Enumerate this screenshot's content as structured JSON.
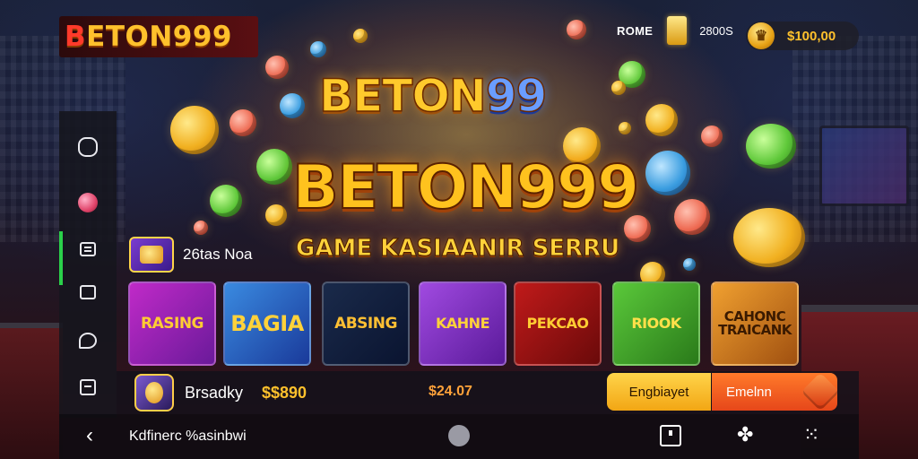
{
  "brand": {
    "logo_text": "BETON999"
  },
  "top_bar": {
    "home_label": "ROME",
    "score": "2800S",
    "balance": "$100,00"
  },
  "headline": {
    "line1_a": "BETON",
    "line1_b": "99",
    "line2": "BETON999",
    "line3": "GAME KASIAANIR SERRU"
  },
  "category": {
    "label": "26tas Noa"
  },
  "games": [
    {
      "title": "RASING"
    },
    {
      "title": "BAGIA"
    },
    {
      "title": "ABSING"
    },
    {
      "title": "KAHNE"
    },
    {
      "title": "PEKCAO"
    },
    {
      "title": "RIOOK"
    },
    {
      "title": "CAHONC TRAICANK"
    }
  ],
  "player": {
    "name": "Brsadky",
    "amount": "$$890",
    "mid_amount": "$24.07"
  },
  "actions": {
    "primary": "Engbiayet",
    "secondary": "Emelnn"
  },
  "system_bar": {
    "title": "Kdfinerc %asinbwi"
  },
  "colors": {
    "accent_gold": "#ffc12c",
    "active_green": "#2ad04a",
    "button_yellow": "#ffd44a",
    "button_orange": "#ff7a2a"
  },
  "icons": {
    "sidebar": [
      "refresh-icon",
      "candy-icon",
      "list-icon",
      "square-icon",
      "chat-icon",
      "wallet-icon"
    ],
    "system": [
      "back-arrow-icon",
      "home-dot-icon",
      "recent-apps-icon",
      "pinwheel-icon",
      "grid-dots-icon"
    ]
  }
}
